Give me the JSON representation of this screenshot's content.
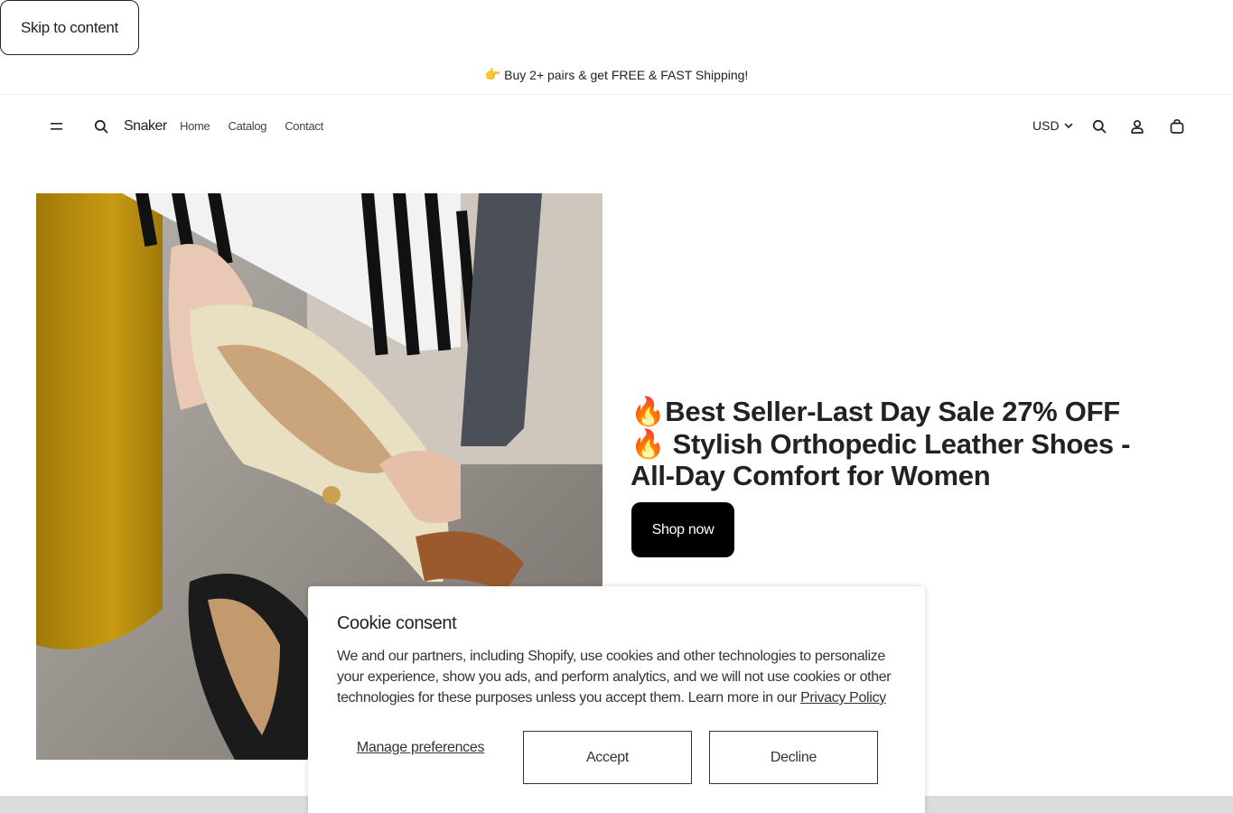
{
  "skip_link": "Skip to content",
  "announcement": {
    "emoji": "👉",
    "text": "Buy 2+ pairs & get FREE & FAST Shipping!"
  },
  "header": {
    "brand": "Snaker",
    "nav": [
      "Home",
      "Catalog",
      "Contact"
    ],
    "currency": "USD"
  },
  "hero": {
    "title": "🔥Best Seller-Last Day Sale 27% OFF🔥 Stylish Orthopedic Leather Shoes - All-Day Comfort for Women",
    "cta": "Shop now"
  },
  "cookie": {
    "title": "Cookie consent",
    "description": "We and our partners, including Shopify, use cookies and other technologies to personalize your experience, show you ads, and perform analytics, and we will not use cookies or other technologies for these purposes unless you accept them. Learn more in our ",
    "privacy_link": "Privacy Policy",
    "manage": "Manage preferences",
    "accept": "Accept",
    "decline": "Decline"
  },
  "icons": {
    "menu": "menu-icon",
    "search": "search-icon",
    "chevron": "chevron-down-icon",
    "account": "account-icon",
    "cart": "cart-icon"
  }
}
